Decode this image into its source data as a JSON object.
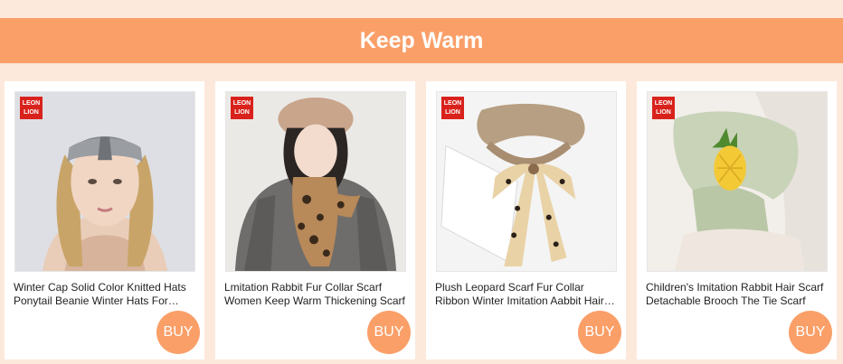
{
  "section": {
    "title": "Keep Warm"
  },
  "colors": {
    "banner": "#fa9f68",
    "button": "#fa9f68",
    "page_bg": "#fde9dc",
    "brand": "#d9221c"
  },
  "products": [
    {
      "brand_top": "LEON",
      "brand_bottom": "LION",
      "image_icon": "knit-headband-photo",
      "title": "Winter Cap Solid Color Knitted Hats Ponytail Beanie Winter Hats For Women",
      "buy_label": "BUY"
    },
    {
      "brand_top": "LEON",
      "brand_bottom": "LION",
      "image_icon": "leopard-fur-scarf-photo",
      "title": "Lmitation Rabbit Fur Collar Scarf Women Keep Warm Thickening Scarf",
      "buy_label": "BUY"
    },
    {
      "brand_top": "LEON",
      "brand_bottom": "LION",
      "image_icon": "plush-leopard-collar-photo",
      "title": "Plush Leopard Scarf Fur Collar Ribbon Winter Imitation Aabbit Hair Scarf",
      "buy_label": "BUY"
    },
    {
      "brand_top": "LEON",
      "brand_bottom": "LION",
      "image_icon": "pineapple-brooch-scarf-photo",
      "title": "Children's Imitation Rabbit Hair Scarf Detachable Brooch The Tie Scarf",
      "buy_label": "BUY"
    }
  ]
}
